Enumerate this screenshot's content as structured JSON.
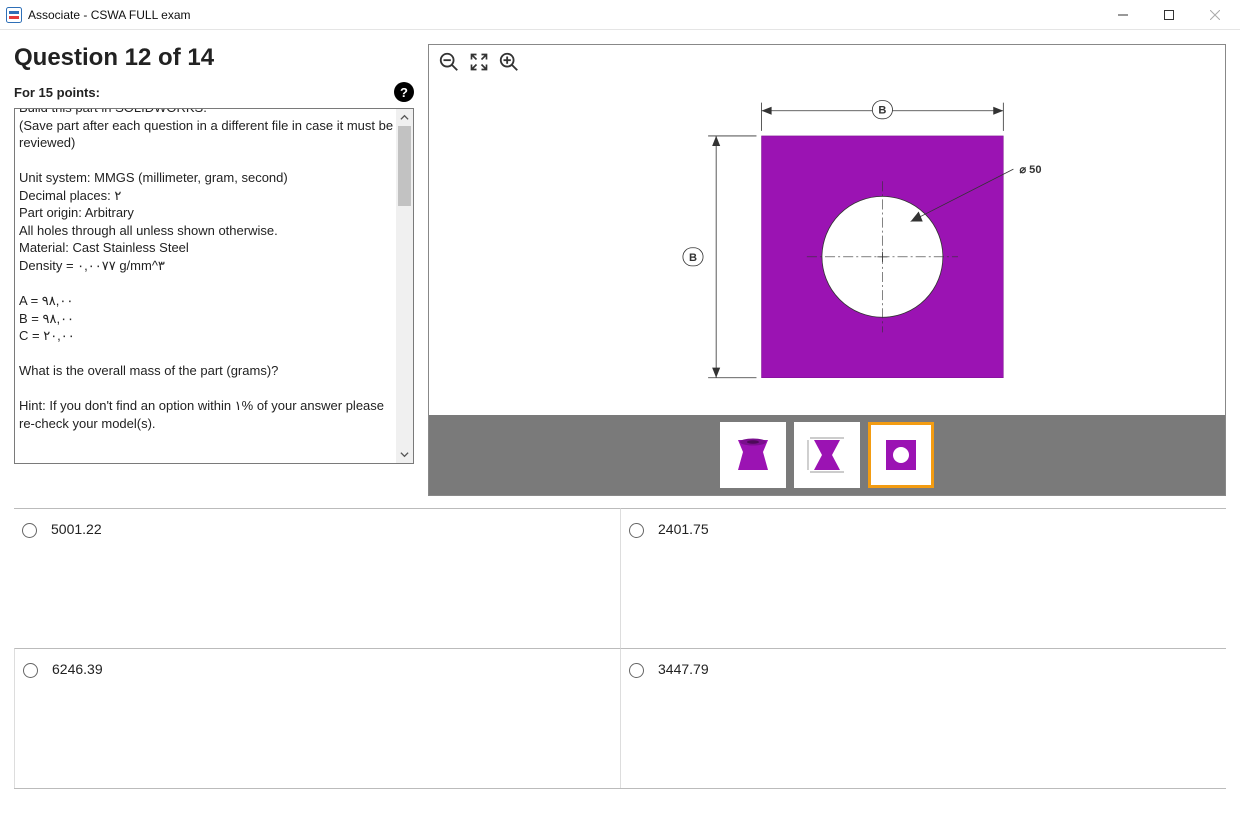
{
  "window": {
    "title": "Associate - CSWA FULL exam"
  },
  "question": {
    "header": "Question 12 of 14",
    "points_label": "For 15 points:",
    "body": "Build this part in SOLIDWORKS.\n(Save part after each question in a different file in case it must be reviewed)\n\nUnit system: MMGS (millimeter, gram, second)\nDecimal places: ٢\nPart origin: Arbitrary\nAll holes through all unless shown otherwise.\nMaterial: Cast Stainless Steel\nDensity = ٠,٠٠٧٧ g/mm^٣\n\nA = ٩٨,٠٠\nB = ٩٨,٠٠\nC = ٢٠,٠٠\n\nWhat is the overall mass of the part (grams)?\n\nHint: If you don't find an option within ١% of your answer please re-check your model(s)."
  },
  "drawing": {
    "dim_B_top": "B",
    "dim_B_left": "B",
    "diameter_callout": "⌀ 50"
  },
  "answers": [
    {
      "label": "5001.22"
    },
    {
      "label": "2401.75"
    },
    {
      "label": "6246.39"
    },
    {
      "label": "3447.79"
    }
  ],
  "thumbs": {
    "selected_index": 2
  }
}
